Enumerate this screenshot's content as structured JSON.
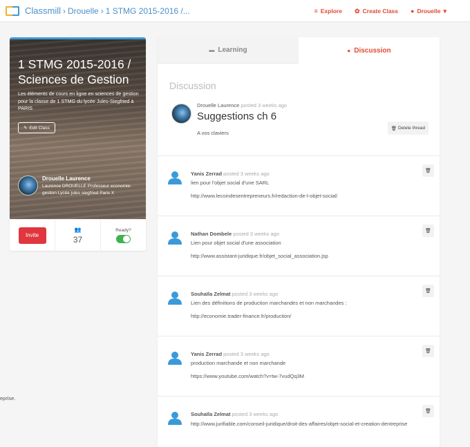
{
  "header": {
    "brand": "Classmill",
    "crumbs": [
      "Drouelle",
      "1 STMG 2015-2016 /..."
    ],
    "nav": {
      "explore": "Explore",
      "create_class": "Create Class",
      "user": "Drouelle"
    }
  },
  "class_card": {
    "title": "1 STMG 2015-2016 / Sciences de Gestion",
    "description": "Les éléments de cours en ligne en sciences de gestion pour la classe de 1 STMG du lycée Jules-Siegfried à PARIS",
    "edit_label": "Edit Class",
    "teacher_name": "Drouelle Laurence",
    "teacher_bio": "Laurence DROUELLE Professeur economie-gestion Lycée jules siegfried Paris X",
    "invite_label": "Invite",
    "members_count": "37",
    "ready_label": "Ready?",
    "ready_on": true
  },
  "left_cut_text": "eprise.",
  "tabs": {
    "learning": "Learning",
    "discussion": "Discussion"
  },
  "thread": {
    "section_title": "Discussion",
    "author": "Drouelle Laurence",
    "posted": "posted 3 weeks ago",
    "title": "Suggestions ch 6",
    "body": "A vos claviers",
    "delete_label": "Delete thread"
  },
  "replies": [
    {
      "author": "Yanis Zerrad",
      "posted": "posted 3 weeks ago",
      "text": "lien pour l'objet social d'une SARL",
      "link": "http://www.lecoindesentrepreneurs.fr/redaction-de-l-objet-social/"
    },
    {
      "author": "Nathan Dombele",
      "posted": "posted 3 weeks ago",
      "text": "Lien pour objet social d'une association",
      "link": "http://www.assistant-juridique.fr/objet_social_association.jsp"
    },
    {
      "author": "Souhaïla Zelmat",
      "posted": "posted 3 weeks ago",
      "text": "Lien des définitions de production marchandes et non marchandes :",
      "link": "http://economie.trader-finance.fr/production/"
    },
    {
      "author": "Yanis Zerrad",
      "posted": "posted 3 weeks ago",
      "text": "production marchande et non marchande",
      "link": "https://www.youtube.com/watch?v=tw-7vudQq3M"
    },
    {
      "author": "Souhaïla Zelmat",
      "posted": "posted 3 weeks ago",
      "text": "http://www.jurifiable.com/conseil-juridique/droit-des-affaires/objet-social-et-creation-dentreprise",
      "link": ""
    }
  ],
  "colors": {
    "accent_red": "#e04a33",
    "link_blue": "#4a90c9",
    "toggle_green": "#3fb24f",
    "invite_red": "#e0363e"
  }
}
